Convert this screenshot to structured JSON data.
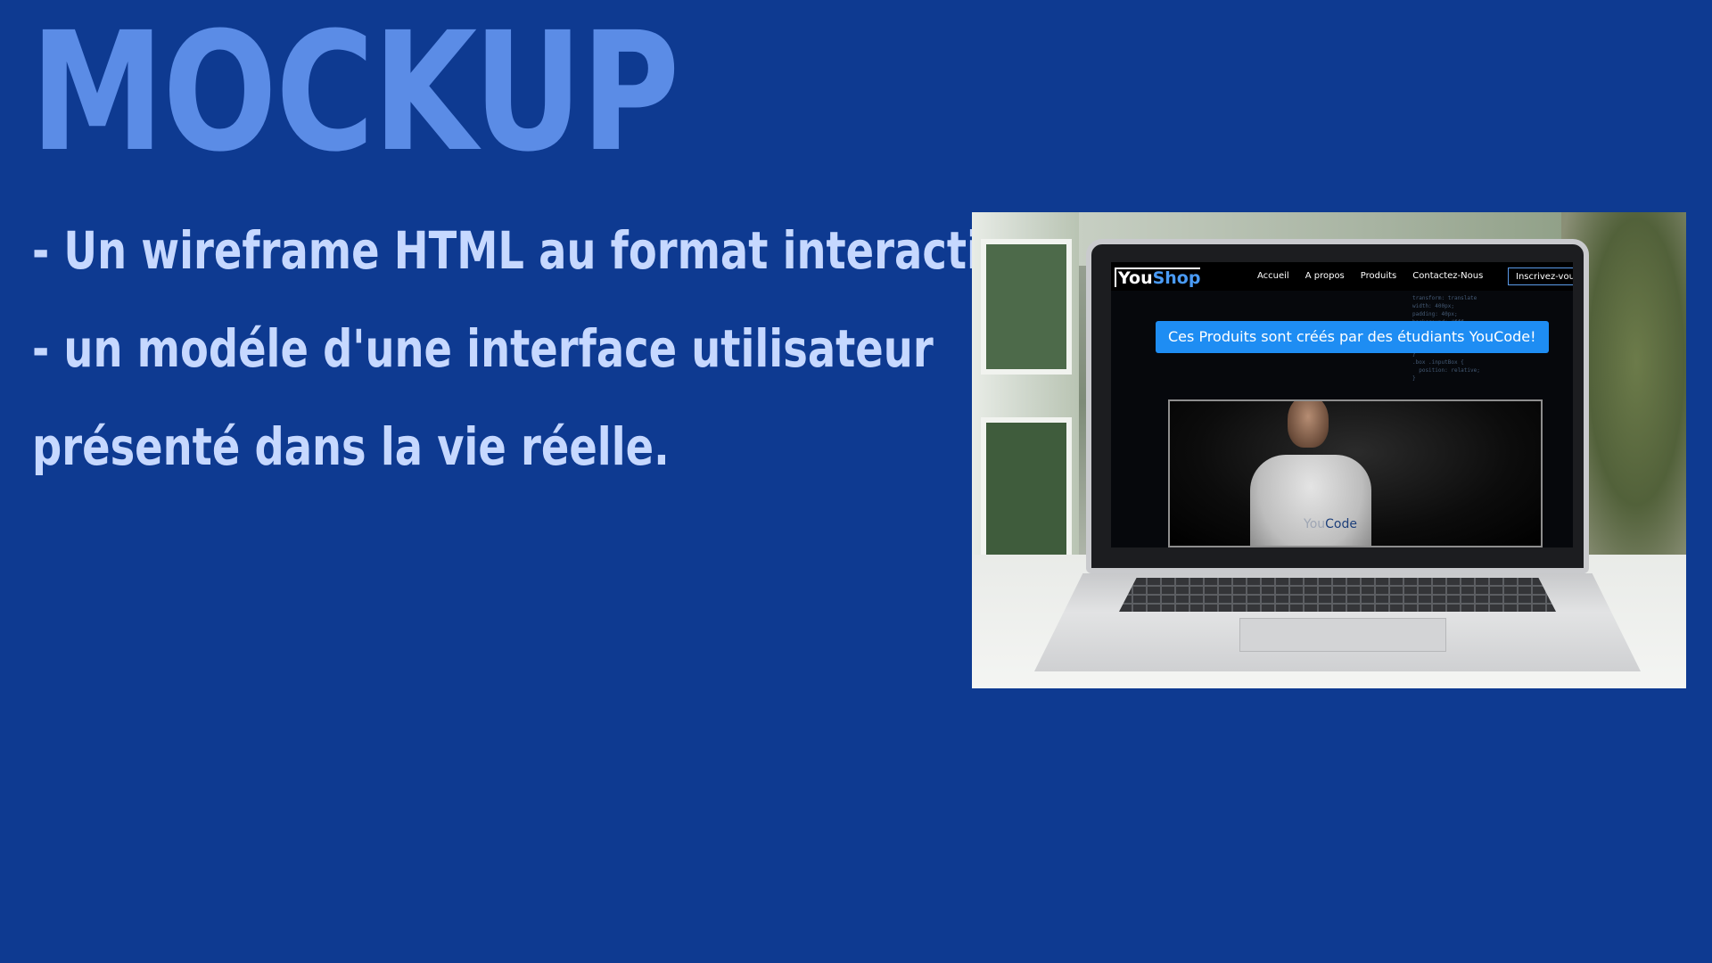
{
  "slide": {
    "title": "MOCKUP",
    "bullets": [
      "- Un wireframe HTML au format interactif.",
      "- un modéle d'une interface utilisateur",
      "présenté dans la vie réelle."
    ]
  },
  "mockup_site": {
    "logo_main": "You",
    "logo_accent": "Shop",
    "nav_items": [
      "Accueil",
      "A propos",
      "Produits",
      "Contactez-Nous"
    ],
    "signup_label": "Inscrivez-vous",
    "banner_text": "Ces Produits sont créés par des étudiants YouCode!",
    "shirt_logo_a": "You",
    "shirt_logo_b": "Code"
  },
  "colors": {
    "background": "#0e3a91",
    "title": "#5b8ce6",
    "bullets": "#c6d8ff",
    "accent_blue": "#1e8df3"
  }
}
